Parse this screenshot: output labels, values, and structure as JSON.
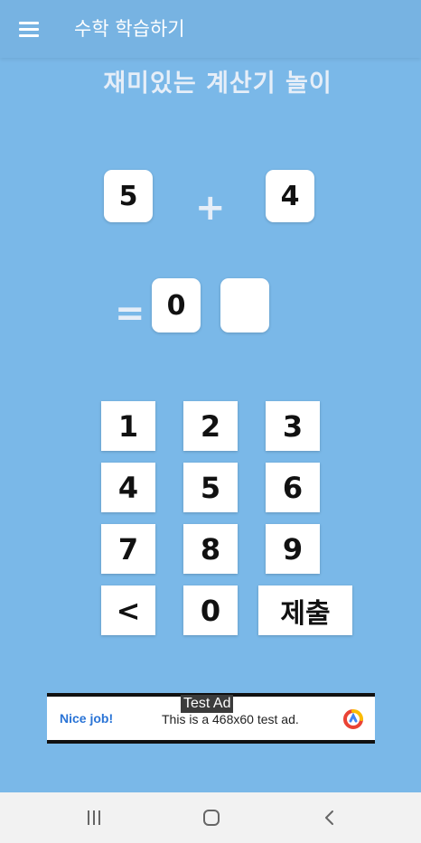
{
  "app_bar": {
    "title": "수학 학습하기",
    "menu_icon": "hamburger-menu-icon"
  },
  "headline": "재미있는 계산기 놀이",
  "problem": {
    "operand1": "5",
    "operator": "+",
    "operand2": "4",
    "equals": "=",
    "answer_digit1": "0",
    "answer_digit2": ""
  },
  "keypad": {
    "keys": [
      "1",
      "2",
      "3",
      "4",
      "5",
      "6",
      "7",
      "8",
      "9",
      "<",
      "0",
      "제출"
    ]
  },
  "ad": {
    "tag": "Test Ad",
    "nice": "Nice job!",
    "text": "This is a 468x60 test ad.",
    "logo_icon": "adchoices-logo-icon"
  },
  "navbar": {
    "recents_icon": "recents-icon",
    "home_icon": "home-icon",
    "back_icon": "back-icon"
  },
  "colors": {
    "background": "#7ab8e8",
    "app_bar": "#77b3e2",
    "key": "#ffffff",
    "ad_link": "#2a74d6"
  }
}
